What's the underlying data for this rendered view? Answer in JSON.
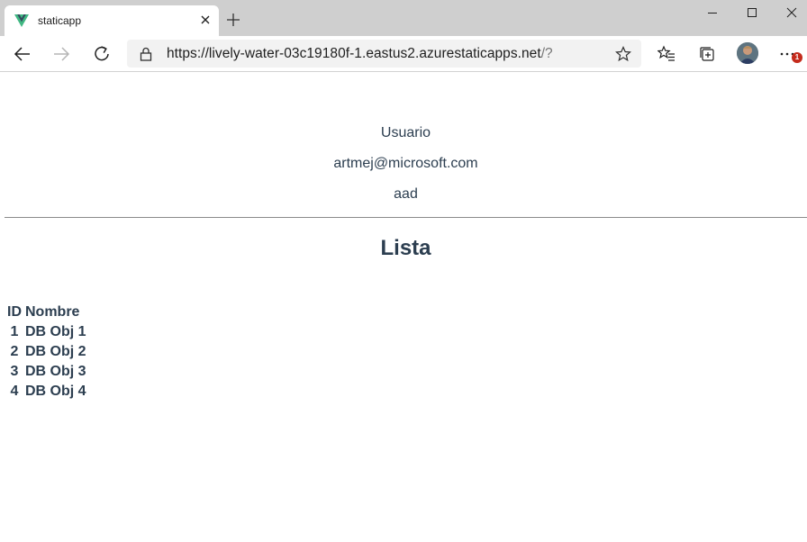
{
  "tab": {
    "title": "staticapp"
  },
  "address": {
    "url_main": "https://lively-water-03c19180f-1.eastus2.azurestaticapps.net",
    "url_rest": "/?"
  },
  "toolbar": {
    "notification_count": "1"
  },
  "user": {
    "title": "Usuario",
    "email": "artmej@microsoft.com",
    "provider": "aad"
  },
  "list": {
    "heading": "Lista",
    "columns": {
      "id": "ID",
      "name": "Nombre"
    },
    "rows": [
      {
        "id": "1",
        "name": "DB Obj 1"
      },
      {
        "id": "2",
        "name": "DB Obj 2"
      },
      {
        "id": "3",
        "name": "DB Obj 3"
      },
      {
        "id": "4",
        "name": "DB Obj 4"
      }
    ]
  },
  "colors": {
    "text": "#2c3e50",
    "vue_green": "#41b883",
    "vue_dark": "#34495e",
    "tabstrip": "#cfcfcf"
  },
  "icons": [
    "vue-logo-icon",
    "close-icon",
    "plus-icon",
    "minimize-icon",
    "maximize-icon",
    "window-close-icon",
    "back-arrow-icon",
    "forward-arrow-icon",
    "refresh-icon",
    "lock-icon",
    "star-icon",
    "favorites-icon",
    "collections-icon",
    "more-icon"
  ]
}
